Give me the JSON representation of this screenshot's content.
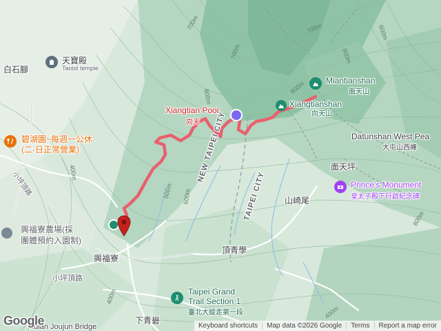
{
  "map": {
    "places": {
      "baishijiao": "白石腳",
      "tianbaodian_zh": "天寶殿",
      "tianbaodian_en": "Taoist temple",
      "bihuyuan_line1": "碧湖園~每週一公休",
      "bihuyuan_line2": "(二-日正常營業)",
      "xiaopingding_road_top": "小坪頂路",
      "xinfuliao_farm_line1": "興福寮農場(採",
      "xinfuliao_farm_line2": "團體預約入園制)",
      "xinfuliao": "興福寮",
      "xiaopingding_road_bottom": "小坪頂路",
      "xiangtian_pool_en": "Xiangtian Pool",
      "xiangtian_pool_zh": "向天",
      "xiangtianshan_en": "Xiangtianshan",
      "xiangtianshan_zh": "向天山",
      "miantianshan_en": "Miantianshan",
      "miantianshan_zh": "面天山",
      "datunshan_west_en": "Datunshan West Pea",
      "datunshan_west_zh": "大屯山西峰",
      "miantianping": "面天坪",
      "princes_monument_en": "Prince's Monument",
      "princes_monument_zh": "皇太子殿下行啟紀念碑",
      "shanqiwei": "山崎尾",
      "dingqingxue": "頂青學",
      "taipei_grand_trail_line1": "Taipei Grand",
      "taipei_grand_trail_line2": "Trail Section 1",
      "taipei_grand_trail_zh": "臺北大縱走第一段",
      "xiaqingbao": "下青礐",
      "new_taipei_city": "NEW TAIPEI CITY",
      "taipei_city": "TAIPEI CITY",
      "neijun_bridge": "Fidian Joujun Bridge"
    },
    "contours": [
      "700m",
      "700m",
      "700m",
      "600m",
      "800m",
      "800m",
      "900m",
      "400m",
      "400m",
      "500m",
      "600m",
      "400m",
      "800m"
    ],
    "icons": {
      "temple": "temple-icon",
      "restaurant": "fork-knife-icon",
      "farm": "place-icon",
      "peak": "mountain-icon",
      "monument": "camera-icon",
      "trail": "hiking-icon",
      "start": "map-pin-icon"
    },
    "colors": {
      "route": "#e8606d",
      "peak_green": "#1e8e6e",
      "restaurant_orange": "#e8710a",
      "monument_purple": "#a142f4",
      "label_red": "#c5221f",
      "water_pool": "#7b68ee"
    }
  },
  "footer": {
    "keyboard": "Keyboard shortcuts",
    "map_data": "Map data ©2026 Google",
    "terms": "Terms",
    "report": "Report a map error"
  },
  "logo": "Google"
}
